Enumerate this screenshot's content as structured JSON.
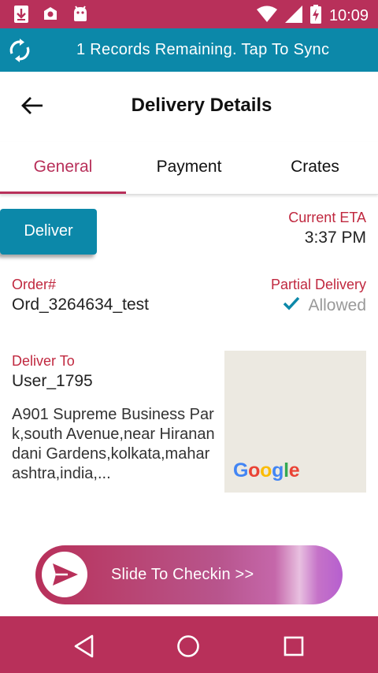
{
  "status_bar": {
    "time": "10:09",
    "left_icons": [
      "download-icon",
      "app-icon",
      "android-icon"
    ],
    "right_icons": [
      "wifi-icon",
      "signal-icon",
      "battery-charging-icon"
    ]
  },
  "sync_bar": {
    "icon": "sync-icon",
    "text": "1 Records Remaining. Tap To Sync"
  },
  "toolbar": {
    "back_icon": "arrow-left-icon",
    "title": "Delivery Details"
  },
  "tabs": [
    {
      "label": "General",
      "active": true
    },
    {
      "label": "Payment",
      "active": false
    },
    {
      "label": "Crates",
      "active": false
    }
  ],
  "details": {
    "deliver_button": "Deliver",
    "current_eta_label": "Current ETA",
    "current_eta_value": "3:37 PM",
    "order_label": "Order#",
    "order_value": "Ord_3264634_test",
    "partial_label": "Partial Delivery",
    "partial_value": "Allowed",
    "deliver_to_label": "Deliver To",
    "deliver_to_value": "User_1795",
    "address": "A901 Supreme Business Park,south Avenue,near Hiranandani Gardens,kolkata,maharashtra,india,..."
  },
  "map": {
    "logo_letters": [
      "G",
      "o",
      "o",
      "g",
      "l",
      "e"
    ],
    "logo_colors": [
      "#4285F4",
      "#EA4335",
      "#FBBC05",
      "#4285F4",
      "#34A853",
      "#EA4335"
    ]
  },
  "slider": {
    "label": "Slide To Checkin >>",
    "icon": "send-icon"
  },
  "nav_bar": {
    "buttons": [
      "back-triangle-icon",
      "home-circle-icon",
      "recents-square-icon"
    ]
  },
  "colors": {
    "accent": "#b8305a",
    "teal": "#0c88a9",
    "label_red": "#c0283f"
  }
}
